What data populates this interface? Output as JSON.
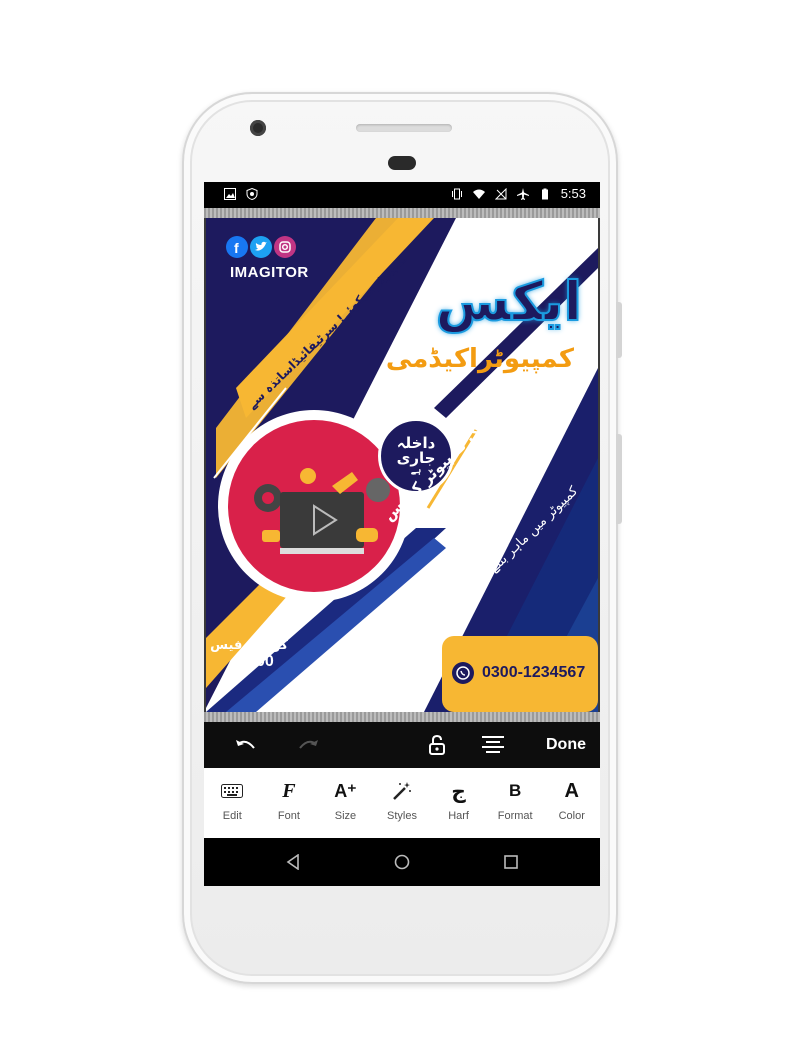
{
  "status_bar": {
    "time": "5:53"
  },
  "poster": {
    "brand": "IMAGITOR",
    "title": "ایکس",
    "subtitle": "کمپیوٹراکیڈمی",
    "banner_left": "کمپیوٹرسیکھئے! سرٹیفائیڈاساتذہ سے",
    "admission_line1": "داخلہ",
    "admission_line2": "جاری",
    "admission_line3": "ہے",
    "course_title": "بیسک کمپیوٹر کورس",
    "course_tagline": "کمپیوٹر میں ماہر بننے کا موقع ضائع مت کیجئے",
    "fee_label": "کورس فیس",
    "fee_value": "1500",
    "phone": "0300-1234567",
    "colors": {
      "navy": "#1d1a5e",
      "yellow": "#f7b733",
      "orange": "#f39c12",
      "crimson": "#d9214a",
      "neon_blue": "#1b9be0"
    }
  },
  "editor_toolbar": {
    "done_label": "Done"
  },
  "tool_tabs": [
    {
      "label": "Edit",
      "icon": "keyboard-icon"
    },
    {
      "label": "Font",
      "icon": "font-icon",
      "glyph": "F"
    },
    {
      "label": "Size",
      "icon": "text-size-icon",
      "glyph": "A⁺"
    },
    {
      "label": "Styles",
      "icon": "magic-wand-icon"
    },
    {
      "label": "Harf",
      "icon": "harf-icon",
      "glyph": "ج"
    },
    {
      "label": "Format",
      "icon": "bold-icon",
      "glyph": "B"
    },
    {
      "label": "Color",
      "icon": "text-color-icon",
      "glyph": "A"
    }
  ]
}
